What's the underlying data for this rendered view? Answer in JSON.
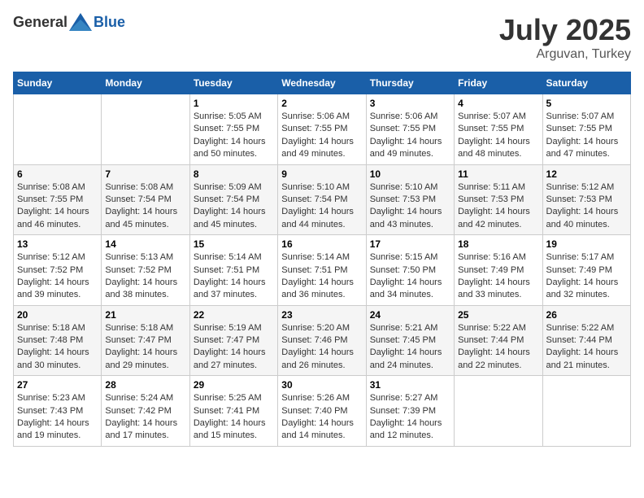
{
  "header": {
    "logo": {
      "general": "General",
      "blue": "Blue"
    },
    "month": "July 2025",
    "location": "Arguvan, Turkey"
  },
  "days_of_week": [
    "Sunday",
    "Monday",
    "Tuesday",
    "Wednesday",
    "Thursday",
    "Friday",
    "Saturday"
  ],
  "weeks": [
    [
      {
        "day": null,
        "info": null
      },
      {
        "day": null,
        "info": null
      },
      {
        "day": "1",
        "info": "Sunrise: 5:05 AM\nSunset: 7:55 PM\nDaylight: 14 hours and 50 minutes."
      },
      {
        "day": "2",
        "info": "Sunrise: 5:06 AM\nSunset: 7:55 PM\nDaylight: 14 hours and 49 minutes."
      },
      {
        "day": "3",
        "info": "Sunrise: 5:06 AM\nSunset: 7:55 PM\nDaylight: 14 hours and 49 minutes."
      },
      {
        "day": "4",
        "info": "Sunrise: 5:07 AM\nSunset: 7:55 PM\nDaylight: 14 hours and 48 minutes."
      },
      {
        "day": "5",
        "info": "Sunrise: 5:07 AM\nSunset: 7:55 PM\nDaylight: 14 hours and 47 minutes."
      }
    ],
    [
      {
        "day": "6",
        "info": "Sunrise: 5:08 AM\nSunset: 7:55 PM\nDaylight: 14 hours and 46 minutes."
      },
      {
        "day": "7",
        "info": "Sunrise: 5:08 AM\nSunset: 7:54 PM\nDaylight: 14 hours and 45 minutes."
      },
      {
        "day": "8",
        "info": "Sunrise: 5:09 AM\nSunset: 7:54 PM\nDaylight: 14 hours and 45 minutes."
      },
      {
        "day": "9",
        "info": "Sunrise: 5:10 AM\nSunset: 7:54 PM\nDaylight: 14 hours and 44 minutes."
      },
      {
        "day": "10",
        "info": "Sunrise: 5:10 AM\nSunset: 7:53 PM\nDaylight: 14 hours and 43 minutes."
      },
      {
        "day": "11",
        "info": "Sunrise: 5:11 AM\nSunset: 7:53 PM\nDaylight: 14 hours and 42 minutes."
      },
      {
        "day": "12",
        "info": "Sunrise: 5:12 AM\nSunset: 7:53 PM\nDaylight: 14 hours and 40 minutes."
      }
    ],
    [
      {
        "day": "13",
        "info": "Sunrise: 5:12 AM\nSunset: 7:52 PM\nDaylight: 14 hours and 39 minutes."
      },
      {
        "day": "14",
        "info": "Sunrise: 5:13 AM\nSunset: 7:52 PM\nDaylight: 14 hours and 38 minutes."
      },
      {
        "day": "15",
        "info": "Sunrise: 5:14 AM\nSunset: 7:51 PM\nDaylight: 14 hours and 37 minutes."
      },
      {
        "day": "16",
        "info": "Sunrise: 5:14 AM\nSunset: 7:51 PM\nDaylight: 14 hours and 36 minutes."
      },
      {
        "day": "17",
        "info": "Sunrise: 5:15 AM\nSunset: 7:50 PM\nDaylight: 14 hours and 34 minutes."
      },
      {
        "day": "18",
        "info": "Sunrise: 5:16 AM\nSunset: 7:49 PM\nDaylight: 14 hours and 33 minutes."
      },
      {
        "day": "19",
        "info": "Sunrise: 5:17 AM\nSunset: 7:49 PM\nDaylight: 14 hours and 32 minutes."
      }
    ],
    [
      {
        "day": "20",
        "info": "Sunrise: 5:18 AM\nSunset: 7:48 PM\nDaylight: 14 hours and 30 minutes."
      },
      {
        "day": "21",
        "info": "Sunrise: 5:18 AM\nSunset: 7:47 PM\nDaylight: 14 hours and 29 minutes."
      },
      {
        "day": "22",
        "info": "Sunrise: 5:19 AM\nSunset: 7:47 PM\nDaylight: 14 hours and 27 minutes."
      },
      {
        "day": "23",
        "info": "Sunrise: 5:20 AM\nSunset: 7:46 PM\nDaylight: 14 hours and 26 minutes."
      },
      {
        "day": "24",
        "info": "Sunrise: 5:21 AM\nSunset: 7:45 PM\nDaylight: 14 hours and 24 minutes."
      },
      {
        "day": "25",
        "info": "Sunrise: 5:22 AM\nSunset: 7:44 PM\nDaylight: 14 hours and 22 minutes."
      },
      {
        "day": "26",
        "info": "Sunrise: 5:22 AM\nSunset: 7:44 PM\nDaylight: 14 hours and 21 minutes."
      }
    ],
    [
      {
        "day": "27",
        "info": "Sunrise: 5:23 AM\nSunset: 7:43 PM\nDaylight: 14 hours and 19 minutes."
      },
      {
        "day": "28",
        "info": "Sunrise: 5:24 AM\nSunset: 7:42 PM\nDaylight: 14 hours and 17 minutes."
      },
      {
        "day": "29",
        "info": "Sunrise: 5:25 AM\nSunset: 7:41 PM\nDaylight: 14 hours and 15 minutes."
      },
      {
        "day": "30",
        "info": "Sunrise: 5:26 AM\nSunset: 7:40 PM\nDaylight: 14 hours and 14 minutes."
      },
      {
        "day": "31",
        "info": "Sunrise: 5:27 AM\nSunset: 7:39 PM\nDaylight: 14 hours and 12 minutes."
      },
      {
        "day": null,
        "info": null
      },
      {
        "day": null,
        "info": null
      }
    ]
  ]
}
